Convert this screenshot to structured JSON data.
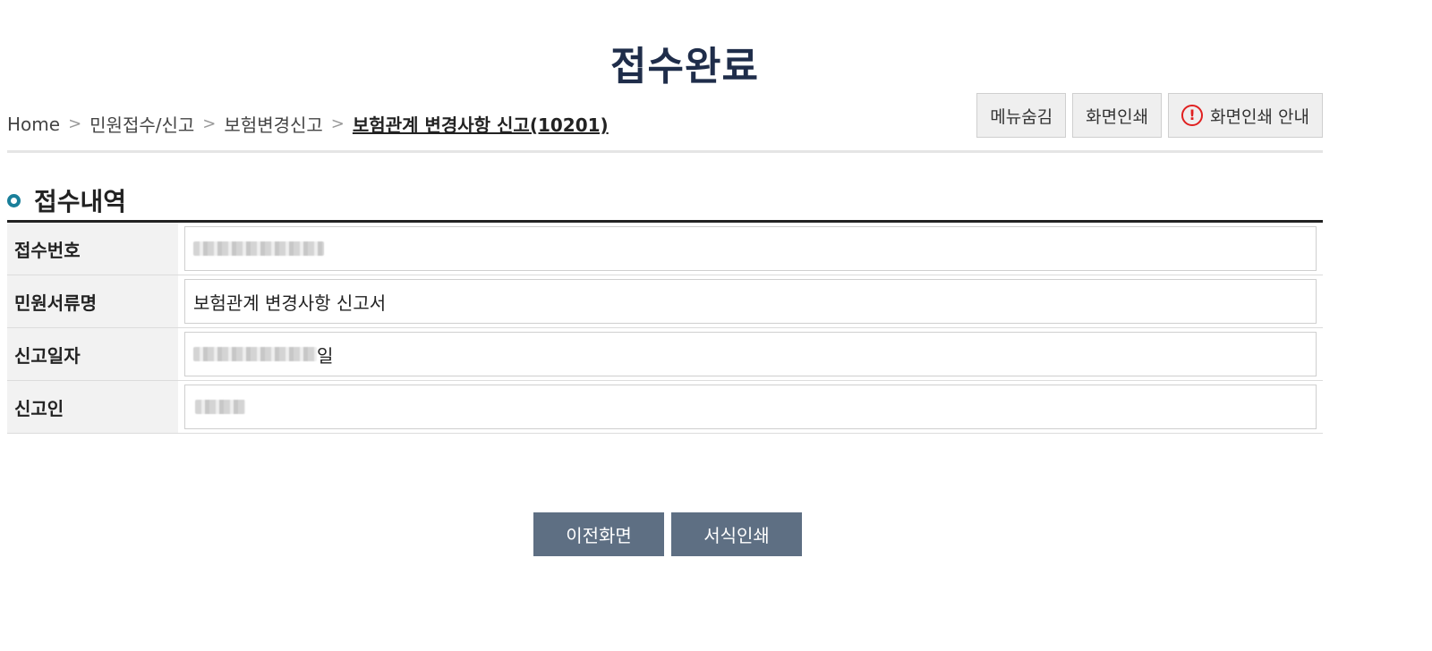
{
  "page": {
    "title": "접수완료"
  },
  "breadcrumb": {
    "items": [
      "Home",
      "민원접수/신고",
      "보험변경신고"
    ],
    "current": "보험관계 변경사항 신고(10201)"
  },
  "toolbar": {
    "hide_menu": "메뉴숨김",
    "print_screen": "화면인쇄",
    "print_guide": "화면인쇄 안내"
  },
  "section": {
    "title": "접수내역"
  },
  "receipt": {
    "rows": [
      {
        "label": "접수번호",
        "value": "",
        "masked": true
      },
      {
        "label": "민원서류명",
        "value": "보험관계 변경사항 신고서",
        "masked": false
      },
      {
        "label": "신고일자",
        "value": "일",
        "masked": true
      },
      {
        "label": "신고인",
        "value": "",
        "masked": true
      }
    ]
  },
  "actions": {
    "prev": "이전화면",
    "print_form": "서식인쇄"
  },
  "colors": {
    "title": "#1f2d4a",
    "bullet": "#1a7f9a",
    "action_button": "#5e6f83",
    "warn": "#e02020"
  },
  "icons": {
    "chevron": "chevron-right-icon",
    "warning": "exclamation-circle-icon",
    "bullet": "ring-bullet-icon"
  }
}
